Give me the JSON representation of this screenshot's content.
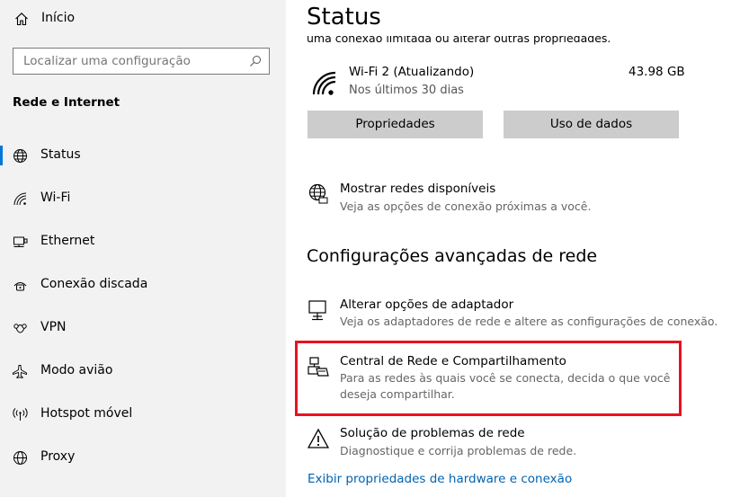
{
  "sidebar": {
    "home_label": "Início",
    "search_placeholder": "Localizar uma configuração",
    "section_title": "Rede e Internet",
    "items": [
      {
        "label": "Status",
        "icon": "globe-icon",
        "selected": true
      },
      {
        "label": "Wi-Fi",
        "icon": "wifi-icon",
        "selected": false
      },
      {
        "label": "Ethernet",
        "icon": "ethernet-icon",
        "selected": false
      },
      {
        "label": "Conexão discada",
        "icon": "dialup-icon",
        "selected": false
      },
      {
        "label": "VPN",
        "icon": "vpn-icon",
        "selected": false
      },
      {
        "label": "Modo avião",
        "icon": "airplane-icon",
        "selected": false
      },
      {
        "label": "Hotspot móvel",
        "icon": "hotspot-icon",
        "selected": false
      },
      {
        "label": "Proxy",
        "icon": "proxy-globe-icon",
        "selected": false
      }
    ]
  },
  "main": {
    "title": "Status",
    "clipped_text": "uma conexão limitada ou alterar outras propriedades.",
    "network": {
      "name": "Wi-Fi 2 (Atualizando)",
      "period": "Nos últimos 30 dias",
      "usage": "43.98 GB"
    },
    "buttons": {
      "properties": "Propriedades",
      "data_usage": "Uso de dados"
    },
    "show_networks": {
      "title": "Mostrar redes disponíveis",
      "subtitle": "Veja as opções de conexão próximas a você."
    },
    "advanced_heading": "Configurações avançadas de rede",
    "adapter": {
      "title": "Alterar opções de adaptador",
      "subtitle": "Veja os adaptadores de rede e altere as configurações de conexão."
    },
    "sharing_center": {
      "title": "Central de Rede e Compartilhamento",
      "subtitle": "Para as redes às quais você se conecta, decida o que você deseja compartilhar."
    },
    "troubleshoot": {
      "title": "Solução de problemas de rede",
      "subtitle": "Diagnostique e corrija problemas de rede."
    },
    "hardware_link": "Exibir propriedades de hardware e conexão"
  },
  "colors": {
    "accent": "#0078d7",
    "highlight": "#e81123",
    "link": "#0063b1",
    "sidebar_bg": "#f2f2f2",
    "button_bg": "#cccccc"
  }
}
